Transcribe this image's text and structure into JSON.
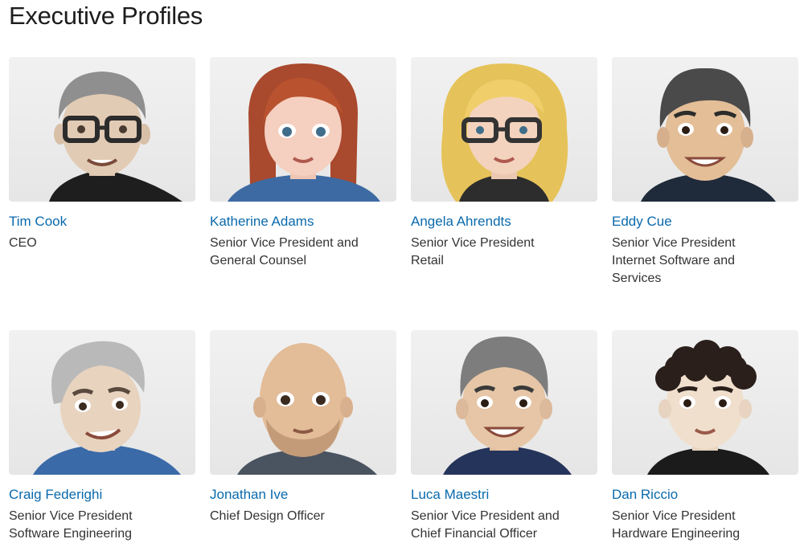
{
  "page": {
    "title": "Executive Profiles"
  },
  "colors": {
    "link": "#0a6aad",
    "card_background": "#eeeeee",
    "text": "#1d1d1f"
  },
  "executives": [
    {
      "name": "Tim Cook",
      "role_lines": [
        "CEO"
      ],
      "avatar": "memoji-gray-hair-glasses-icon"
    },
    {
      "name": "Katherine Adams",
      "role_lines": [
        "Senior Vice President and",
        "General Counsel"
      ],
      "avatar": "memoji-red-hair-icon"
    },
    {
      "name": "Angela Ahrendts",
      "role_lines": [
        "Senior Vice President",
        "Retail"
      ],
      "avatar": "memoji-blonde-glasses-icon"
    },
    {
      "name": "Eddy Cue",
      "role_lines": [
        "Senior Vice President",
        "Internet Software and",
        "Services"
      ],
      "avatar": "memoji-dark-hair-smile-icon"
    },
    {
      "name": "Craig Federighi",
      "role_lines": [
        "Senior Vice President",
        "Software Engineering"
      ],
      "avatar": "memoji-silver-hair-icon"
    },
    {
      "name": "Jonathan Ive",
      "role_lines": [
        "Chief Design Officer"
      ],
      "avatar": "memoji-bald-beard-icon"
    },
    {
      "name": "Luca Maestri",
      "role_lines": [
        "Senior Vice President and",
        "Chief Financial Officer"
      ],
      "avatar": "memoji-gray-hair-smile-icon"
    },
    {
      "name": "Dan Riccio",
      "role_lines": [
        "Senior Vice President",
        "Hardware Engineering"
      ],
      "avatar": "memoji-curly-hair-icon"
    }
  ]
}
